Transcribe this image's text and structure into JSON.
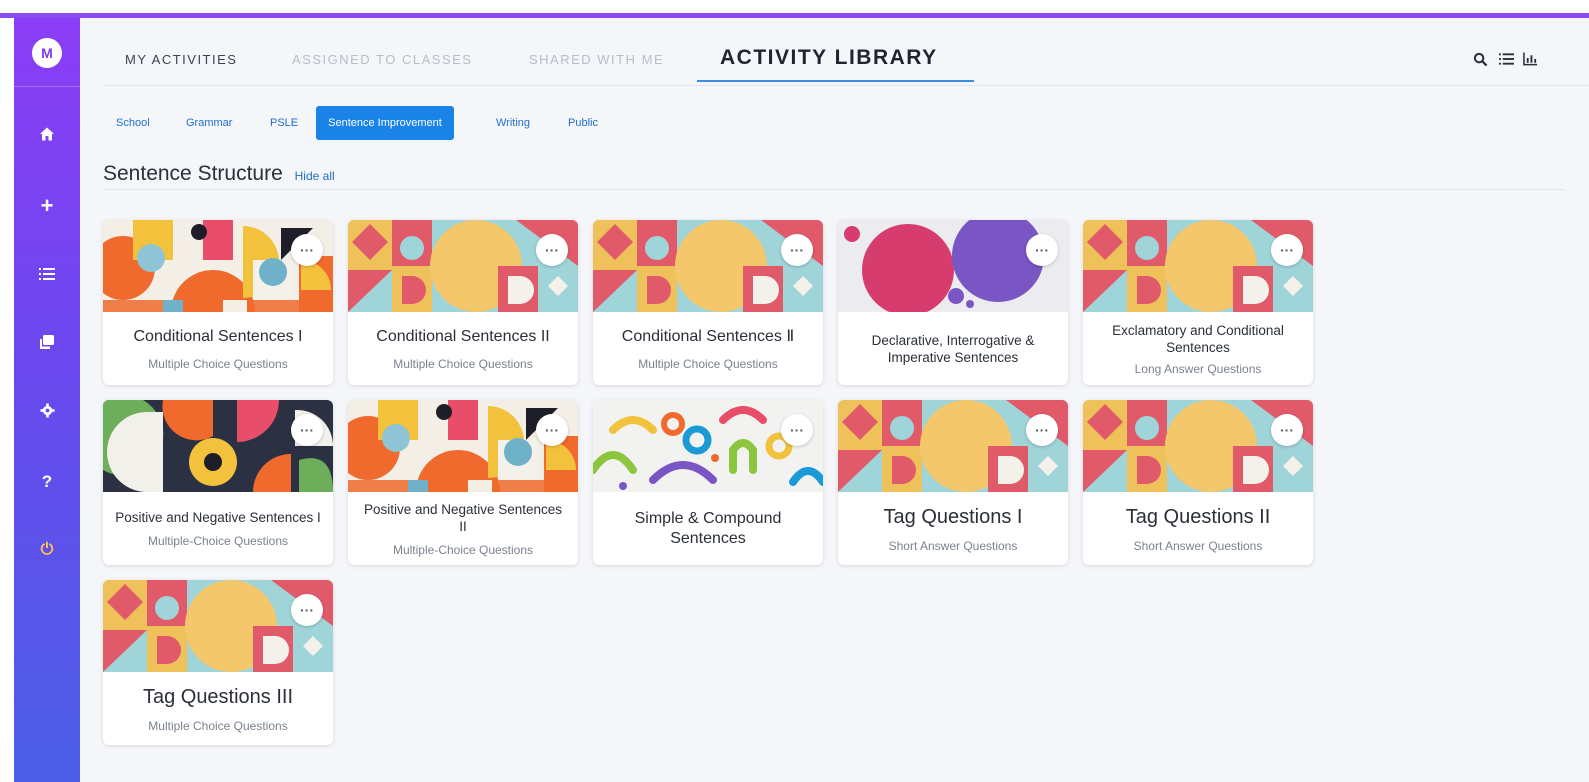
{
  "sidebar": {
    "avatar_initial": "M",
    "items": [
      {
        "name": "home",
        "icon": "home-icon"
      },
      {
        "name": "create",
        "icon": "plus-icon"
      },
      {
        "name": "activities",
        "icon": "list-icon"
      },
      {
        "name": "library",
        "icon": "copy-icon"
      },
      {
        "name": "settings",
        "icon": "gear-icon"
      },
      {
        "name": "help",
        "icon": "question-icon"
      },
      {
        "name": "logout",
        "icon": "power-icon"
      }
    ],
    "help_glyph": "?",
    "plus_glyph": "+",
    "power_glyph": "⏻"
  },
  "header": {
    "tabs": [
      "MY ACTIVITIES",
      "ASSIGNED TO CLASSES",
      "SHARED WITH ME",
      "ACTIVITY LIBRARY"
    ],
    "active_tab": "ACTIVITY LIBRARY",
    "tools": [
      "search-icon",
      "list-view-icon",
      "chart-icon"
    ]
  },
  "filters": {
    "chips": [
      "School",
      "Grammar",
      "PSLE",
      "Sentence Improvement",
      "Writing",
      "Public"
    ],
    "active_chip": "Sentence Improvement"
  },
  "section": {
    "title": "Sentence Structure",
    "toggle_label": "Hide all"
  },
  "cards": [
    {
      "title": "Conditional Sentences I",
      "subtitle": "Multiple Choice Questions"
    },
    {
      "title": "Conditional Sentences II",
      "subtitle": "Multiple Choice Questions"
    },
    {
      "title": "Conditional Sentences Ⅱ",
      "subtitle": "Multiple Choice Questions"
    },
    {
      "title": "Declarative, Interrogative & Imperative Sentences",
      "subtitle": ""
    },
    {
      "title": "Exclamatory and Conditional Sentences",
      "subtitle": "Long Answer Questions"
    },
    {
      "title": "Positive and Negative Sentences I",
      "subtitle": "Multiple-Choice Questions"
    },
    {
      "title": "Positive and Negative Sentences II",
      "subtitle": "Multiple-Choice Questions"
    },
    {
      "title": "Simple & Compound Sentences",
      "subtitle": ""
    },
    {
      "title": "Tag Questions I",
      "subtitle": "Short Answer Questions"
    },
    {
      "title": "Tag Questions II",
      "subtitle": "Short Answer Questions"
    },
    {
      "title": "Tag Questions III",
      "subtitle": "Multiple Choice Questions"
    }
  ],
  "more_glyph": "···",
  "colors": {
    "sidebar_top": "#8b3df5",
    "sidebar_bottom": "#4b5fe6",
    "accent": "#1a83e8",
    "active_underline": "#3b8de0",
    "power": "#ffc04d"
  }
}
